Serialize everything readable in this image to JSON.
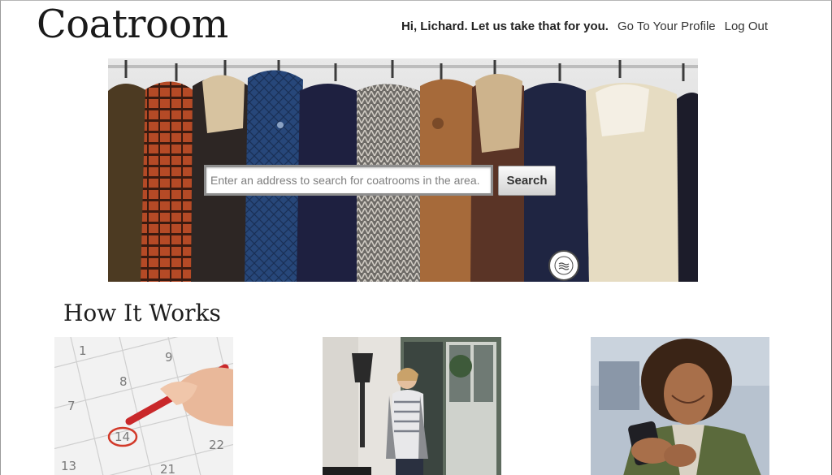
{
  "header": {
    "logo": "Coatroom",
    "greeting": "Hi, Lichard. Let us take that for you.",
    "profile_link": "Go To Your Profile",
    "logout_link": "Log Out"
  },
  "search": {
    "placeholder": "Enter an address to search for coatrooms in the area.",
    "button_label": "Search"
  },
  "how_it_works": {
    "title": "How It Works"
  },
  "calendar": {
    "numbers": [
      "9",
      "8",
      "7",
      "14",
      "13",
      "21",
      "22",
      "1"
    ]
  }
}
